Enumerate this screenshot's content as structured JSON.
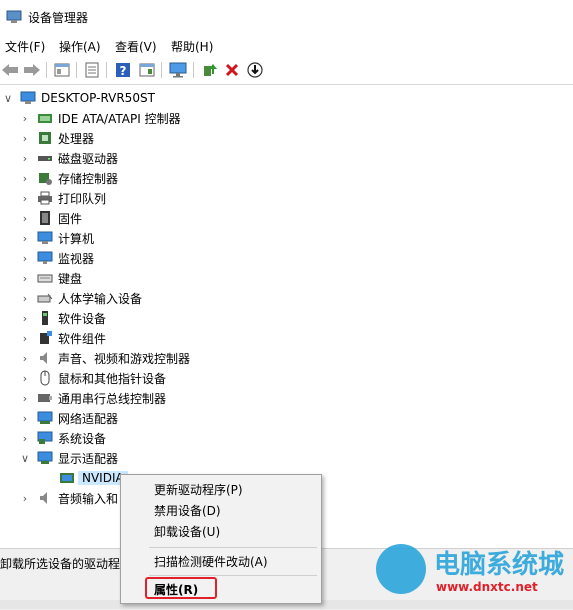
{
  "window": {
    "title": "设备管理器"
  },
  "menu": [
    "文件(F)",
    "操作(A)",
    "查看(V)",
    "帮助(H)"
  ],
  "toolbar": {
    "icons": [
      "back-arrow-icon",
      "forward-arrow-icon",
      "properties-icon",
      "list-icon",
      "help-icon",
      "view-icon",
      "monitor-icon",
      "update-driver-icon",
      "uninstall-icon",
      "download-icon"
    ]
  },
  "tree": {
    "root": "DESKTOP-RVR50ST",
    "items": [
      {
        "label": "IDE ATA/ATAPI 控制器",
        "icon": "ide-controller-icon"
      },
      {
        "label": "处理器",
        "icon": "processor-icon"
      },
      {
        "label": "磁盘驱动器",
        "icon": "disk-drive-icon"
      },
      {
        "label": "存储控制器",
        "icon": "storage-controller-icon"
      },
      {
        "label": "打印队列",
        "icon": "printer-icon"
      },
      {
        "label": "固件",
        "icon": "firmware-icon"
      },
      {
        "label": "计算机",
        "icon": "computer-icon"
      },
      {
        "label": "监视器",
        "icon": "monitor-icon"
      },
      {
        "label": "键盘",
        "icon": "keyboard-icon"
      },
      {
        "label": "人体学输入设备",
        "icon": "hid-icon"
      },
      {
        "label": "软件设备",
        "icon": "software-device-icon"
      },
      {
        "label": "软件组件",
        "icon": "software-component-icon"
      },
      {
        "label": "声音、视频和游戏控制器",
        "icon": "speaker-icon"
      },
      {
        "label": "鼠标和其他指针设备",
        "icon": "mouse-icon"
      },
      {
        "label": "通用串行总线控制器",
        "icon": "usb-icon"
      },
      {
        "label": "网络适配器",
        "icon": "network-adapter-icon"
      },
      {
        "label": "系统设备",
        "icon": "system-device-icon"
      },
      {
        "label": "显示适配器",
        "icon": "display-adapter-icon"
      }
    ],
    "child": "NVIDIA",
    "after_child": "音频输入和"
  },
  "context_menu": {
    "items": [
      "更新驱动程序(P)",
      "禁用设备(D)",
      "卸载设备(U)",
      "扫描检测硬件改动(A)",
      "属性(R)"
    ]
  },
  "status": {
    "text": "卸载所选设备的驱动程"
  },
  "watermark": {
    "text": "电脑系统城",
    "url": "www.dnxtc.net"
  },
  "colors": {
    "selection": "#cce8ff",
    "highlight_border": "#e0202a",
    "watermark": "#1ea0d8"
  }
}
